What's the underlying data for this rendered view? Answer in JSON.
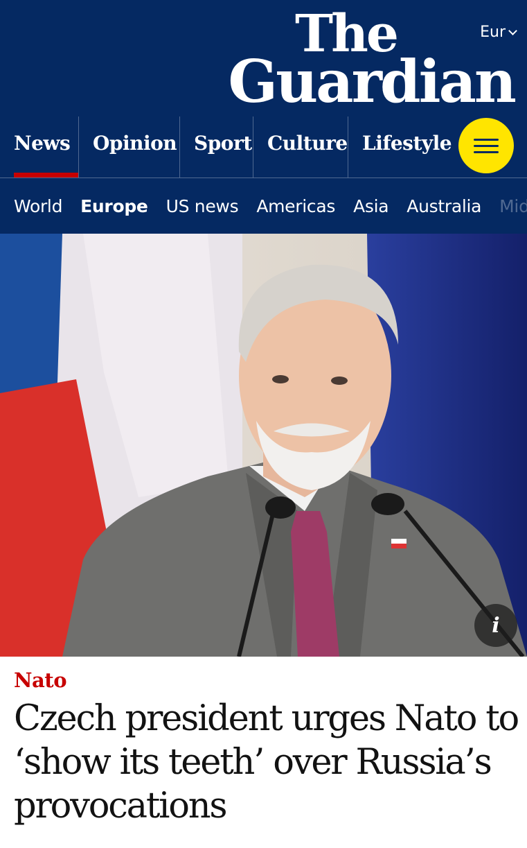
{
  "header": {
    "edition_label": "Eur",
    "logo_line1": "The",
    "logo_line2": "Guardian",
    "pillars": [
      {
        "label": "News"
      },
      {
        "label": "Opinion"
      },
      {
        "label": "Sport"
      },
      {
        "label": "Culture"
      },
      {
        "label": "Lifestyle"
      }
    ],
    "subnav": [
      {
        "label": "World"
      },
      {
        "label": "Europe"
      },
      {
        "label": "US news"
      },
      {
        "label": "Americas"
      },
      {
        "label": "Asia"
      },
      {
        "label": "Australia"
      },
      {
        "label": "Mid"
      }
    ]
  },
  "hero": {
    "info_label": "i"
  },
  "article": {
    "kicker": "Nato",
    "headline": "Czech president urges Nato to ‘show its teeth’ over Russia’s provocations"
  },
  "colors": {
    "brand_blue": "#052962",
    "news_red": "#c70000",
    "menu_yellow": "#ffe500",
    "divider": "#506991"
  },
  "icons": {
    "menu": "menu-icon",
    "edition_dropdown": "chevron-down-icon",
    "info": "info-icon"
  }
}
